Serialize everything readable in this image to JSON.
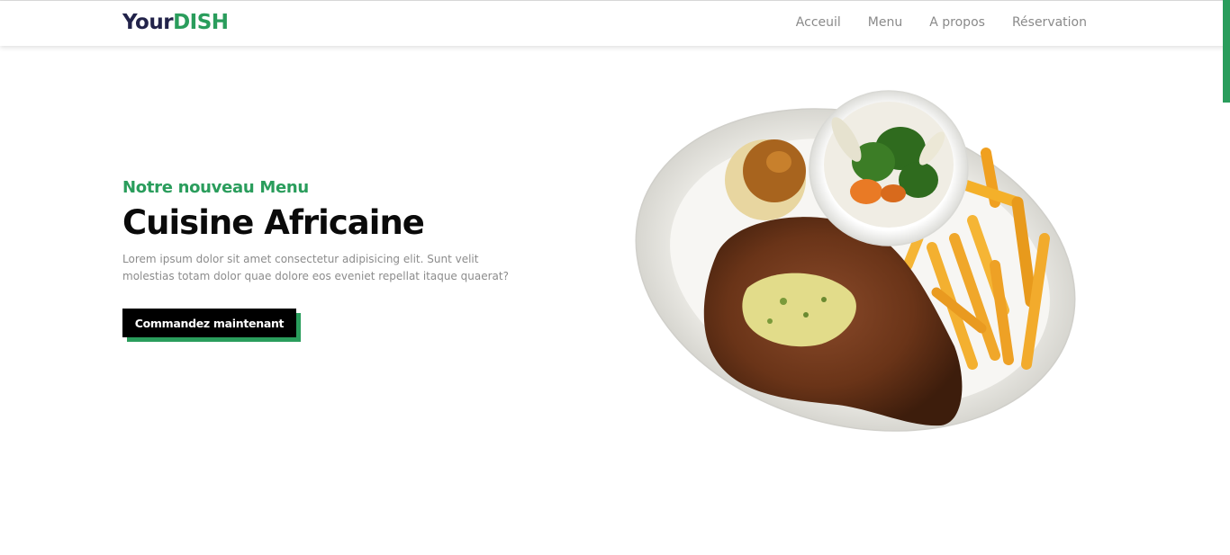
{
  "brand": {
    "part1": "Your",
    "part2": "DISH"
  },
  "nav": [
    {
      "label": "Acceuil"
    },
    {
      "label": "Menu"
    },
    {
      "label": "A propos"
    },
    {
      "label": "Réservation"
    }
  ],
  "hero": {
    "subtitle": "Notre nouveau Menu",
    "title": "Cuisine Africaine",
    "description": "Lorem ipsum dolor sit amet consectetur adipisicing elit. Sunt velit molestias totam dolor quae dolore eos eveniet repellat itaque quaerat?",
    "cta_label": "Commandez maintenant"
  },
  "colors": {
    "accent": "#2a9d5c",
    "brand_dark": "#22234a",
    "text_muted": "#8c8c8c"
  }
}
